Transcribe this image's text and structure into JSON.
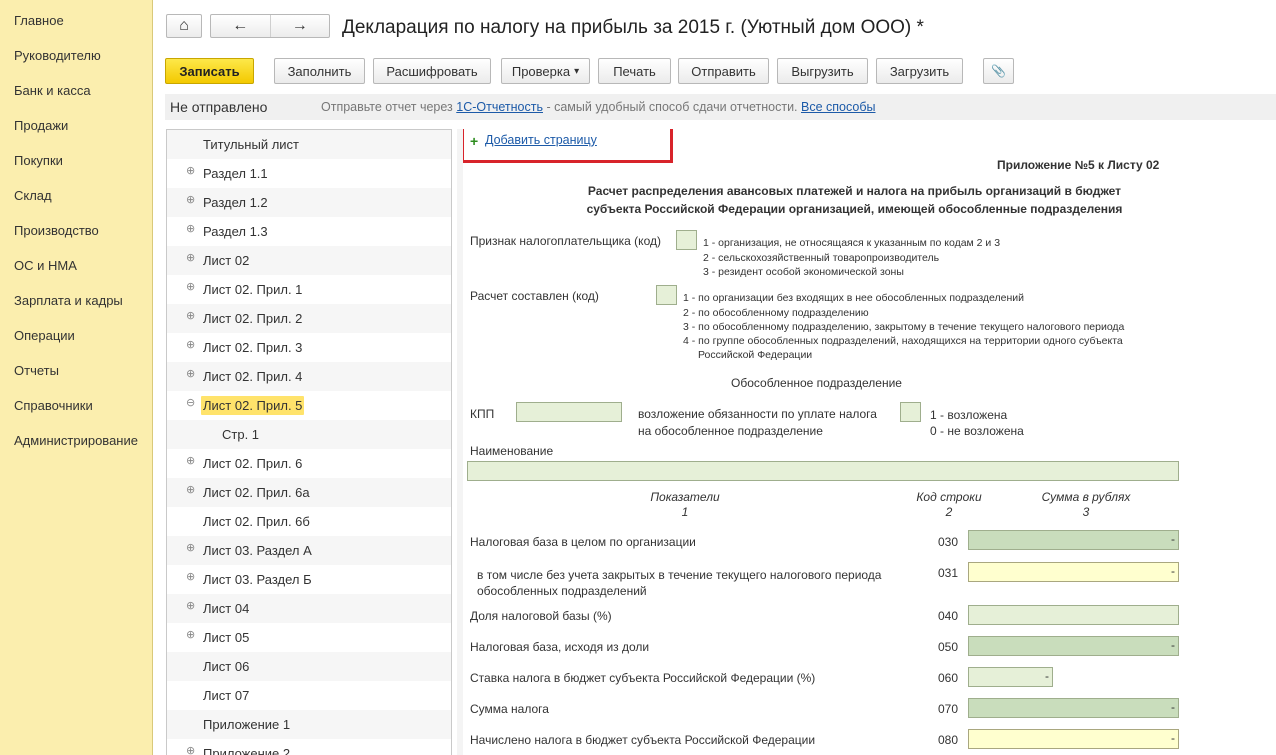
{
  "nav": {
    "items": [
      "Главное",
      "Руководителю",
      "Банк и касса",
      "Продажи",
      "Покупки",
      "Склад",
      "Производство",
      "ОС и НМА",
      "Зарплата и кадры",
      "Операции",
      "Отчеты",
      "Справочники",
      "Администрирование"
    ]
  },
  "header": {
    "title": "Декларация по налогу на прибыль за 2015 г. (Уютный дом ООО) *",
    "home_icon": "⌂",
    "back_icon": "←",
    "forward_icon": "→"
  },
  "toolbar": {
    "save": "Записать",
    "fill": "Заполнить",
    "decode": "Расшифровать",
    "check": "Проверка",
    "check_arrow": "▾",
    "print": "Печать",
    "send": "Отправить",
    "export": "Выгрузить",
    "import": "Загрузить",
    "attach_icon": "📎"
  },
  "status": {
    "state": "Не отправлено",
    "hint_prefix": "Отправьте отчет через",
    "hint_link": "1С-Отчетность",
    "hint_suffix": "- самый удобный способ сдачи отчетности.",
    "all_methods": "Все способы"
  },
  "tree": {
    "items": [
      {
        "label": "Титульный лист",
        "expander": ""
      },
      {
        "label": "Раздел 1.1",
        "expander": "⊕"
      },
      {
        "label": "Раздел 1.2",
        "expander": "⊕"
      },
      {
        "label": "Раздел 1.3",
        "expander": "⊕"
      },
      {
        "label": "Лист 02",
        "expander": "⊕"
      },
      {
        "label": "Лист 02. Прил. 1",
        "expander": "⊕"
      },
      {
        "label": "Лист 02. Прил. 2",
        "expander": "⊕"
      },
      {
        "label": "Лист 02. Прил. 3",
        "expander": "⊕"
      },
      {
        "label": "Лист 02. Прил. 4",
        "expander": "⊕"
      },
      {
        "label": "Лист 02. Прил. 5",
        "expander": "⊖"
      },
      {
        "label": "Стр. 1",
        "expander": ""
      },
      {
        "label": "Лист 02. Прил. 6",
        "expander": "⊕"
      },
      {
        "label": "Лист 02. Прил. 6а",
        "expander": "⊕"
      },
      {
        "label": "Лист 02. Прил. 6б",
        "expander": ""
      },
      {
        "label": "Лист 03. Раздел А",
        "expander": "⊕"
      },
      {
        "label": "Лист 03. Раздел Б",
        "expander": "⊕"
      },
      {
        "label": "Лист 04",
        "expander": "⊕"
      },
      {
        "label": "Лист 05",
        "expander": "⊕"
      },
      {
        "label": "Лист 06",
        "expander": ""
      },
      {
        "label": "Лист 07",
        "expander": ""
      },
      {
        "label": "Приложение 1",
        "expander": ""
      },
      {
        "label": "Приложение 2",
        "expander": "⊕"
      }
    ]
  },
  "form": {
    "add_page": "Добавить страницу",
    "add_icon": "+",
    "appendix": "Приложение №5 к Листу 02",
    "heading_line1": "Расчет распределения авансовых платежей и налога на прибыль организаций в бюджет",
    "heading_line2": "субъекта Российской Федерации организацией, имеющей обособленные подразделения",
    "taxpayer_sign": "Признак налогоплательщика (код)",
    "taxpayer_codes": [
      "1 - организация, не относящаяся к указанным по кодам 2 и 3",
      "2 - сельскохозяйственный товаропроизводитель",
      "3 - резидент особой экономической зоны"
    ],
    "calc_made": "Расчет составлен (код)",
    "calc_codes": [
      "1 - по организации без входящих в нее обособленных подразделений",
      "2 - по обособленному подразделению",
      "3 - по обособленному подразделению, закрытому в течение текущего налогового периода",
      "4 - по группе обособленных подразделений, находящихся на территории одного субъекта",
      "Российской Федерации"
    ],
    "subdivision": "Обособленное подразделение",
    "kpp": "КПП",
    "duty_line1": "возложение обязанности по уплате налога",
    "duty_line2": "на обособленное подразделение",
    "duty_code1": "1 - возложена",
    "duty_code2": "0 - не возложена",
    "name_label": "Наименование",
    "col_indicators": "Показатели",
    "col_line_code": "Код строки",
    "col_sum": "Сумма в рублях",
    "col_n1": "1",
    "col_n2": "2",
    "col_n3": "3",
    "rows": [
      {
        "label": "Налоговая база в целом по организации",
        "code": "030",
        "value": "-"
      },
      {
        "label": "в том числе без учета закрытых в течение текущего налогового периода",
        "label2": "обособленных подразделений",
        "code": "031",
        "value": "-"
      },
      {
        "label": "Доля налоговой базы (%)",
        "code": "040",
        "value": ""
      },
      {
        "label": "Налоговая база, исходя из доли",
        "code": "050",
        "value": "-"
      },
      {
        "label": "Ставка налога в бюджет субъекта Российской Федерации (%)",
        "code": "060",
        "value": "-"
      },
      {
        "label": "Сумма налога",
        "code": "070",
        "value": "-"
      },
      {
        "label": "Начислено налога в бюджет субъекта Российской Федерации",
        "code": "080",
        "value": "-"
      }
    ]
  }
}
